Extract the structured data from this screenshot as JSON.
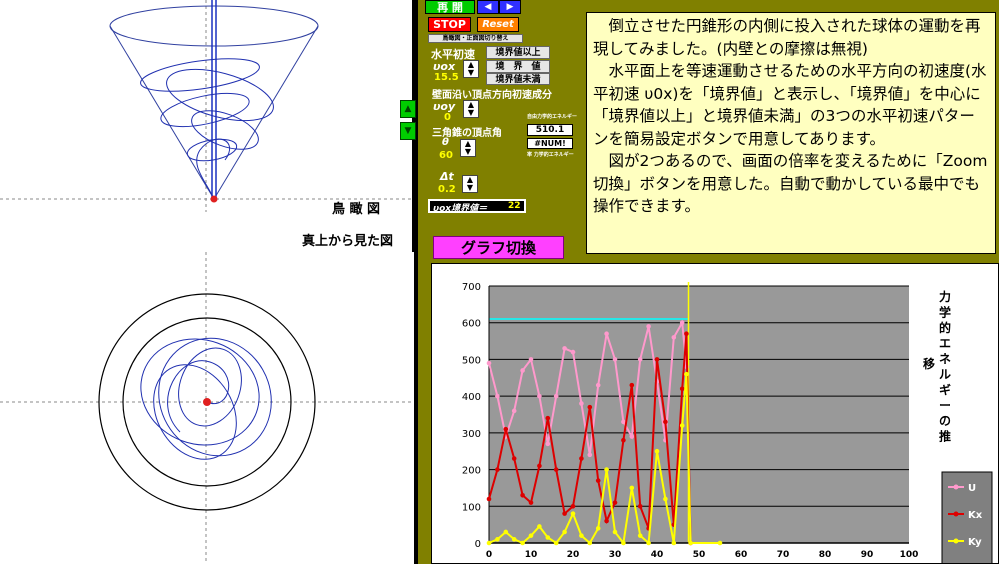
{
  "controls": {
    "resume": "再 開",
    "stop": "STOP",
    "reset": "Reset",
    "view_toggle": "鳥瞰図・正面図切り替え",
    "horizontal_initial": "水平初速",
    "vox_label": "υox",
    "vox_value": "15.5",
    "btn_above": "境界値以上",
    "btn_boundary": "境　界　値",
    "btn_below": "境界値未満",
    "wall_initial": "壁面沿い頂点方向初速成分",
    "voy_label": "υoy",
    "voy_value": "0",
    "apex_angle": "三角錐の頂点角",
    "theta_label": "θ",
    "theta_value": "60",
    "energy_small_label": "自由力学的エネルギー",
    "energy_value": "510.1",
    "error_value": "#NUM!",
    "energy_small_label2": "率 力学的エネルギー",
    "dt_label": "Δt",
    "dt_value": "0.2",
    "boundary_label": "υox境界値＝",
    "boundary_value": "22"
  },
  "views": {
    "bird": "鳥 瞰 図",
    "top": "真上から見た図"
  },
  "description": [
    "倒立させた円錐形の内側に投入された球体の運動を再現してみました。(内壁との摩擦は無視)",
    "水平面上を等速運動させるための水平方向の初速度(水平初速 υ0x)を「境界値」と表示し、「境界値」を中心に「境界値以上」と境界値未満」の3つの水平初速パターンを簡易設定ボタンで用意してあります。",
    "図が2つあるので、画面の倍率を変えるために「Zoom切換」ボタンを用意した。自動で動かしている最中でも操作できます。"
  ],
  "graph_toggle": "グラフ切換",
  "chart_data": {
    "type": "line",
    "title": "力学的エネルギーの推移",
    "title_chars": [
      "力",
      "学",
      "的",
      "エ",
      "ネ",
      "ル",
      "ギ",
      "ー",
      "の",
      "推"
    ],
    "side_char": "移",
    "xlim": [
      0,
      100
    ],
    "ylim": [
      0,
      700
    ],
    "xticks": [
      0,
      10,
      20,
      30,
      40,
      50,
      60,
      70,
      80,
      90,
      100
    ],
    "yticks": [
      0,
      100,
      200,
      300,
      400,
      500,
      600,
      700
    ],
    "total_energy": 610,
    "current_x": 47.5,
    "series": [
      {
        "name": "U",
        "color": "#ff99cc",
        "x": [
          0,
          2,
          4,
          6,
          8,
          10,
          12,
          14,
          16,
          18,
          20,
          22,
          24,
          26,
          28,
          30,
          32,
          34,
          36,
          38,
          40,
          42,
          44,
          46,
          47
        ],
        "y": [
          490,
          400,
          290,
          360,
          470,
          500,
          400,
          270,
          400,
          530,
          520,
          380,
          240,
          430,
          570,
          500,
          330,
          290,
          500,
          590,
          440,
          280,
          560,
          600,
          480
        ]
      },
      {
        "name": "Kx",
        "color": "#dd0000",
        "x": [
          0,
          2,
          4,
          6,
          8,
          10,
          12,
          14,
          16,
          18,
          20,
          22,
          24,
          26,
          28,
          30,
          32,
          34,
          36,
          38,
          40,
          42,
          44,
          46,
          47,
          48
        ],
        "y": [
          120,
          200,
          310,
          230,
          130,
          110,
          210,
          340,
          200,
          80,
          100,
          230,
          370,
          170,
          60,
          110,
          280,
          430,
          100,
          40,
          500,
          330,
          50,
          420,
          570,
          0
        ]
      },
      {
        "name": "Ky",
        "color": "#ffff00",
        "x": [
          0,
          2,
          4,
          6,
          8,
          10,
          12,
          14,
          16,
          18,
          20,
          22,
          24,
          26,
          28,
          30,
          32,
          34,
          36,
          38,
          40,
          42,
          44,
          46,
          47,
          48,
          55
        ],
        "y": [
          0,
          10,
          30,
          10,
          0,
          20,
          45,
          15,
          0,
          30,
          80,
          20,
          0,
          40,
          200,
          30,
          0,
          150,
          20,
          0,
          250,
          120,
          0,
          320,
          460,
          0,
          0
        ]
      }
    ]
  }
}
